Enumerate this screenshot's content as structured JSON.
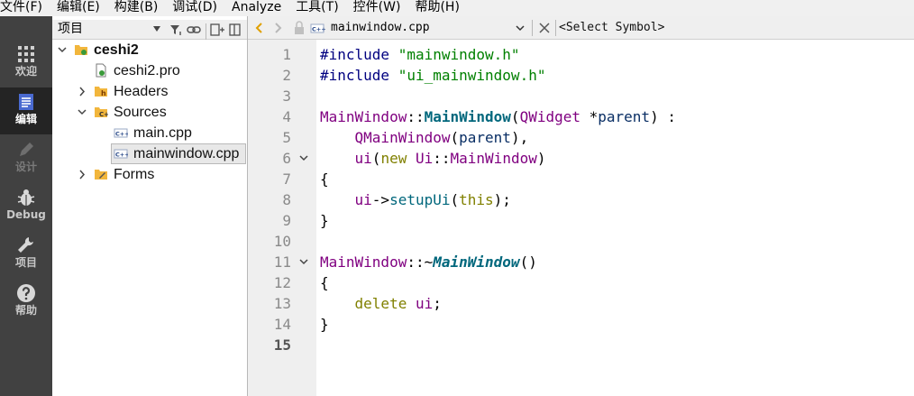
{
  "menu": [
    "文件(F)",
    "编辑(E)",
    "构建(B)",
    "调试(D)",
    "Analyze",
    "工具(T)",
    "控件(W)",
    "帮助(H)"
  ],
  "modes": [
    {
      "label": "欢迎",
      "icon": "grid-icon",
      "active": false
    },
    {
      "label": "编辑",
      "icon": "edit-document-icon",
      "active": true
    },
    {
      "label": "设计",
      "icon": "pencil-icon",
      "active": false,
      "disabled": true
    },
    {
      "label": "Debug",
      "icon": "bug-icon",
      "active": false
    },
    {
      "label": "项目",
      "icon": "wrench-icon",
      "active": false
    },
    {
      "label": "帮助",
      "icon": "help-icon",
      "active": false
    }
  ],
  "project_panel": {
    "view_label": "项目",
    "toolbar_icons": [
      "filter-icon",
      "link-icon",
      "split-icon",
      "close-panel-icon"
    ]
  },
  "tree": [
    {
      "label": "ceshi2",
      "level": 0,
      "expanded": true,
      "icon": "project-folder-icon",
      "bold": true
    },
    {
      "label": "ceshi2.pro",
      "level": 1,
      "icon": "pro-file-icon"
    },
    {
      "label": "Headers",
      "level": 1,
      "expanded": false,
      "icon": "headers-folder-icon"
    },
    {
      "label": "Sources",
      "level": 1,
      "expanded": true,
      "icon": "sources-folder-icon"
    },
    {
      "label": "main.cpp",
      "level": 2,
      "icon": "cpp-file-icon"
    },
    {
      "label": "mainwindow.cpp",
      "level": 2,
      "icon": "cpp-file-icon",
      "selected": true
    },
    {
      "label": "Forms",
      "level": 1,
      "expanded": false,
      "icon": "forms-folder-icon"
    }
  ],
  "editor_toolbar": {
    "file_name": "mainwindow.cpp",
    "symbol_placeholder": "<Select Symbol>"
  },
  "editor": {
    "current_line": 15,
    "lines": [
      {
        "n": "1",
        "fold": false,
        "tokens": [
          [
            "pp",
            "#include "
          ],
          [
            "str",
            "\"mainwindow.h\""
          ]
        ]
      },
      {
        "n": "2",
        "fold": false,
        "tokens": [
          [
            "pp",
            "#include "
          ],
          [
            "str",
            "\"ui_mainwindow.h\""
          ]
        ]
      },
      {
        "n": "3",
        "fold": false,
        "tokens": []
      },
      {
        "n": "4",
        "fold": false,
        "tokens": [
          [
            "type",
            "MainWindow"
          ],
          [
            "plain",
            "::"
          ],
          [
            "fn",
            "MainWindow"
          ],
          [
            "plain",
            "("
          ],
          [
            "type",
            "QWidget"
          ],
          [
            "plain",
            " *"
          ],
          [
            "param",
            "parent"
          ],
          [
            "plain",
            ") :"
          ]
        ]
      },
      {
        "n": "5",
        "fold": false,
        "tokens": [
          [
            "plain",
            "    "
          ],
          [
            "type",
            "QMainWindow"
          ],
          [
            "plain",
            "("
          ],
          [
            "param",
            "parent"
          ],
          [
            "plain",
            "),"
          ]
        ]
      },
      {
        "n": "6",
        "fold": true,
        "tokens": [
          [
            "plain",
            "    "
          ],
          [
            "type",
            "ui"
          ],
          [
            "plain",
            "("
          ],
          [
            "kw",
            "new"
          ],
          [
            "plain",
            " "
          ],
          [
            "type",
            "Ui"
          ],
          [
            "plain",
            "::"
          ],
          [
            "type",
            "MainWindow"
          ],
          [
            "plain",
            ")"
          ]
        ]
      },
      {
        "n": "7",
        "fold": false,
        "tokens": [
          [
            "plain",
            "{"
          ]
        ]
      },
      {
        "n": "8",
        "fold": false,
        "tokens": [
          [
            "plain",
            "    "
          ],
          [
            "type",
            "ui"
          ],
          [
            "plain",
            "->"
          ],
          [
            "call",
            "setupUi"
          ],
          [
            "plain",
            "("
          ],
          [
            "kw",
            "this"
          ],
          [
            "plain",
            ");"
          ]
        ]
      },
      {
        "n": "9",
        "fold": false,
        "tokens": [
          [
            "plain",
            "}"
          ]
        ]
      },
      {
        "n": "10",
        "fold": false,
        "tokens": []
      },
      {
        "n": "11",
        "fold": true,
        "tokens": [
          [
            "type",
            "MainWindow"
          ],
          [
            "plain",
            "::~"
          ],
          [
            "fni",
            "MainWindow"
          ],
          [
            "plain",
            "()"
          ]
        ]
      },
      {
        "n": "12",
        "fold": false,
        "tokens": [
          [
            "plain",
            "{"
          ]
        ]
      },
      {
        "n": "13",
        "fold": false,
        "tokens": [
          [
            "plain",
            "    "
          ],
          [
            "kw",
            "delete"
          ],
          [
            "plain",
            " "
          ],
          [
            "type",
            "ui"
          ],
          [
            "plain",
            ";"
          ]
        ]
      },
      {
        "n": "14",
        "fold": false,
        "tokens": [
          [
            "plain",
            "}"
          ]
        ]
      },
      {
        "n": "15",
        "fold": false,
        "tokens": []
      }
    ]
  },
  "colors": {
    "preprocessor": "#000080",
    "string": "#008000",
    "type": "#800080",
    "function": "#00677c",
    "keyword": "#808000",
    "modebar_bg": "#414141",
    "modebar_active": "#242424"
  }
}
